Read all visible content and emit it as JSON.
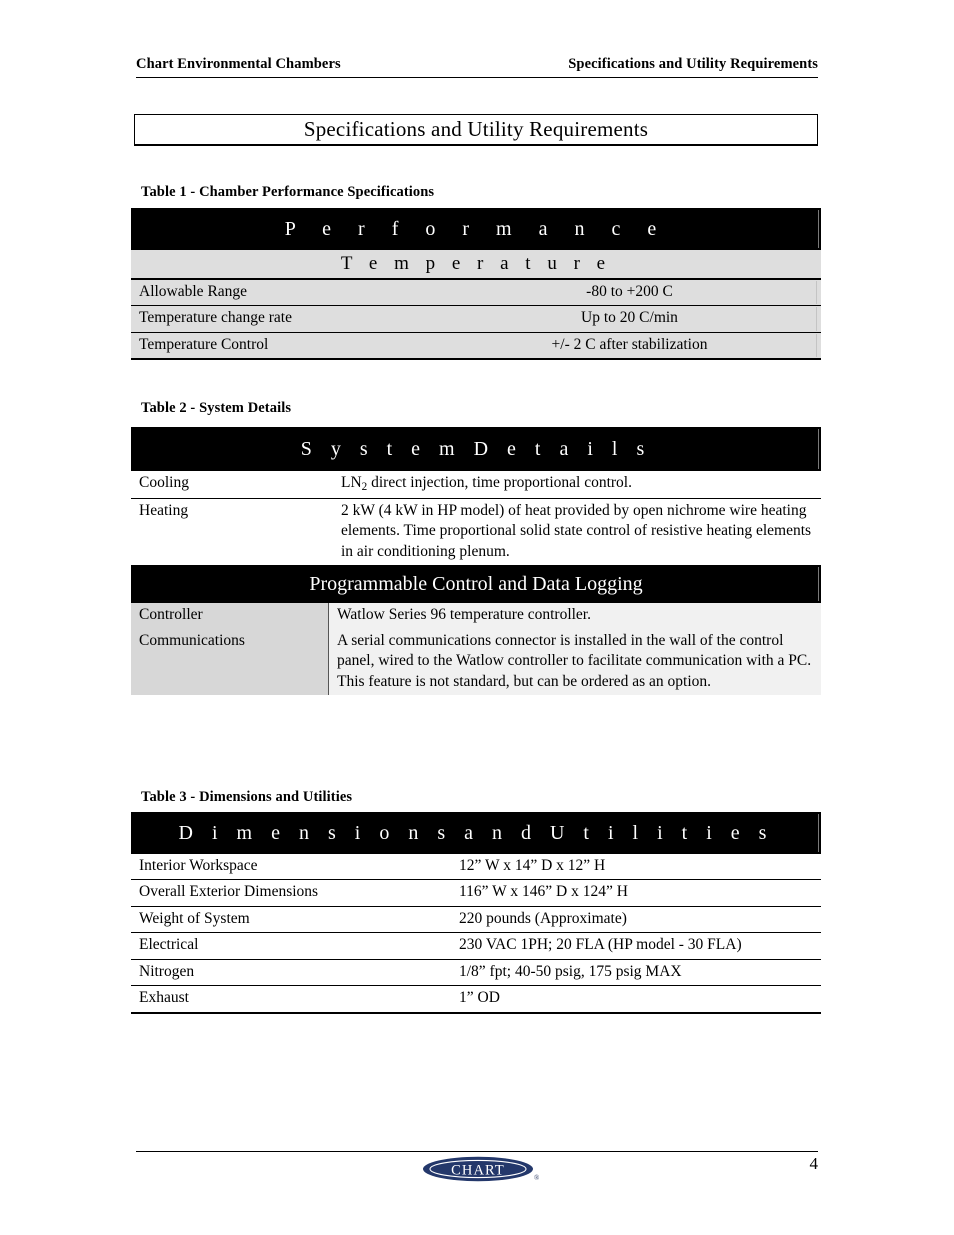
{
  "running_header": {
    "left": "Chart Environmental Chambers",
    "right": "Specifications and Utility Requirements"
  },
  "page_title": "Specifications and Utility Requirements",
  "tables": [
    {
      "caption": "Table 1 - Chamber Performance Specifications",
      "black_header": "P e r f o r m a n c e",
      "gray_header": "T e m p e r a t u r e",
      "rows": [
        {
          "key": "Allowable Range",
          "value": "-80 to +200  C"
        },
        {
          "key": "Temperature change rate",
          "value": "Up to 20  C/min"
        },
        {
          "key": "Temperature Control",
          "value": "+/- 2  C after stabilization"
        }
      ]
    },
    {
      "caption": "Table 2 - System Details",
      "black_header": "S y s t e m     D e t a i l s",
      "rows": [
        {
          "key": "Cooling",
          "value_pre": "LN",
          "value_sub": "2",
          "value_post": " direct injection, time proportional control."
        },
        {
          "key": "Heating",
          "value": "2 kW (4 kW in HP model) of heat provided by open nichrome wire heating elements.  Time proportional solid state control of resistive heating elements in air conditioning plenum."
        }
      ],
      "black_header_2": "Programmable Control and Data Logging",
      "rows_2": [
        {
          "key": "Controller",
          "value": "Watlow Series 96 temperature controller."
        },
        {
          "key": "Communications",
          "value": "A serial communications connector is installed in the wall of the control panel, wired to the Watlow controller to facilitate communication with a PC.  This feature is not standard, but can be ordered as an option."
        }
      ]
    },
    {
      "caption": "Table 3 - Dimensions and Utilities",
      "black_header": "D i m e n s i o n s     a n d     U t i l i t i e s",
      "rows": [
        {
          "key": "Interior Workspace",
          "value": "12” W x 14” D x 12” H"
        },
        {
          "key": "Overall Exterior Dimensions",
          "value": "116” W x 146” D x 124” H"
        },
        {
          "key": "Weight of System",
          "value": "220 pounds (Approximate)"
        },
        {
          "key": "Electrical",
          "value": "230 VAC 1PH; 20 FLA (HP model - 30 FLA)"
        },
        {
          "key": "Nitrogen",
          "value": "1/8” fpt; 40-50 psig, 175 psig MAX"
        },
        {
          "key": "Exhaust",
          "value": "1” OD"
        }
      ]
    }
  ],
  "footer": {
    "page_number": "4",
    "logo_text": "CHART",
    "logo_tm": "®",
    "logo_color": "#24386b"
  }
}
